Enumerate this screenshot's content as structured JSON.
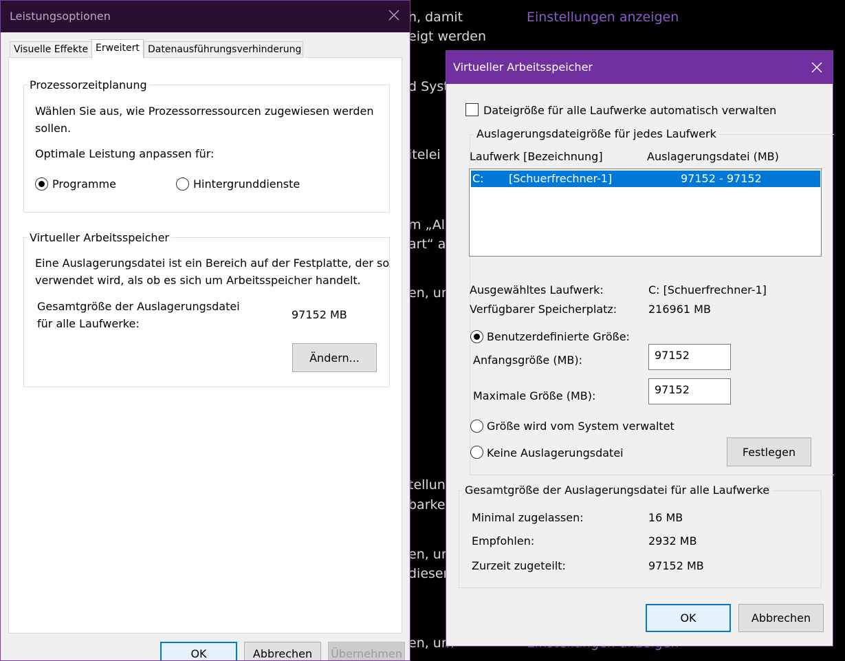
{
  "background": {
    "lines": [
      "n, damit",
      "eigt werden",
      "d Syst",
      "itelei",
      "m „Al",
      "art“ an",
      "en, um",
      "tellung",
      "barke",
      "en, um",
      "dieser",
      "en, um"
    ],
    "link_top": "Einstellungen anzeigen",
    "link_bottom": "Einstellungen anzeigen"
  },
  "perf_window": {
    "title": "Leistungsoptionen",
    "tabs": [
      {
        "label": "Visuelle Effekte",
        "active": false
      },
      {
        "label": "Erweitert",
        "active": true
      },
      {
        "label": "Datenausführungsverhinderung",
        "active": false
      }
    ],
    "cpu_group": {
      "legend": "Prozessorzeitplanung",
      "description_line1": "Wählen Sie aus, wie Prozessorressourcen zugewiesen werden",
      "description_line2": "sollen.",
      "optimize_label": "Optimale Leistung anpassen für:",
      "option_programs": "Programme",
      "option_services": "Hintergrunddienste",
      "selected": "Programme"
    },
    "vm_group": {
      "legend": "Virtueller Arbeitsspeicher",
      "description_line1": "Eine Auslagerungsdatei ist ein Bereich auf der Festplatte, der so",
      "description_line2": "verwendet wird, als ob es sich um Arbeitsspeicher handelt.",
      "total_label_line1": "Gesamtgröße der Auslagerungsdatei",
      "total_label_line2": "für alle Laufwerke:",
      "total_value": "97152 MB",
      "change_button": "Ändern..."
    },
    "buttons": {
      "ok": "OK",
      "cancel": "Abbrechen",
      "apply": "Übernehmen"
    }
  },
  "vm_dialog": {
    "title": "Virtueller Arbeitsspeicher",
    "auto_manage_label": "Dateigröße für alle Laufwerke automatisch verwalten",
    "auto_manage_checked": false,
    "per_drive_legend": "Auslagerungsdateigröße für jedes Laufwerk",
    "columns": {
      "drive": "Laufwerk [Bezeichnung]",
      "paging": "Auslagerungsdatei (MB)"
    },
    "drives": [
      {
        "letter": "C:",
        "label": "[Schuerfrechner-1]",
        "size": "97152 - 97152"
      }
    ],
    "selected_drive_label": "Ausgewähltes Laufwerk:",
    "selected_drive_value": "C:  [Schuerfrechner-1]",
    "free_space_label": "Verfügbarer Speicherplatz:",
    "free_space_value": "216961 MB",
    "custom_size_label": "Benutzerdefinierte Größe:",
    "initial_size_label": "Anfangsgröße (MB):",
    "initial_size_value": "97152",
    "max_size_label": "Maximale Größe (MB):",
    "max_size_value": "97152",
    "system_managed_label": "Größe wird vom System verwaltet",
    "no_paging_label": "Keine Auslagerungsdatei",
    "selected_option": "custom",
    "set_button": "Festlegen",
    "total_legend": "Gesamtgröße der Auslagerungsdatei für alle Laufwerke",
    "min_label": "Minimal zugelassen:",
    "min_value": "16 MB",
    "recommended_label": "Empfohlen:",
    "recommended_value": "2932 MB",
    "allocated_label": "Zurzeit zugeteilt:",
    "allocated_value": "97152 MB",
    "ok_button": "OK",
    "cancel_button": "Abbrechen"
  },
  "colors": {
    "accent": "#7030a0",
    "selection": "#0078d7",
    "perf_titlebar": "#2b0f33"
  }
}
